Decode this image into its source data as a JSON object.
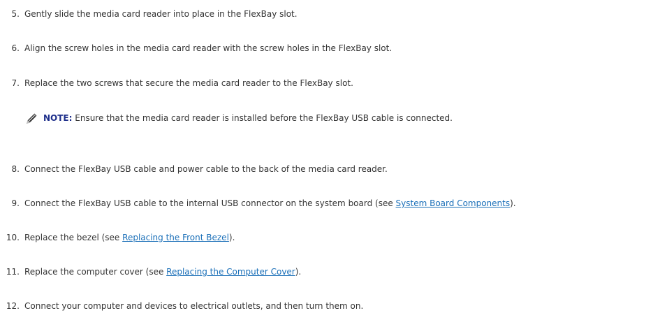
{
  "steps": [
    {
      "num": "5.",
      "before": "Gently slide the media card reader into place in the FlexBay slot.",
      "link": "",
      "after": ""
    },
    {
      "num": "6.",
      "before": "Align the screw holes in the media card reader with the screw holes in the FlexBay slot.",
      "link": "",
      "after": ""
    },
    {
      "num": "7.",
      "before": "Replace the two screws that secure the media card reader to the FlexBay slot.",
      "link": "",
      "after": ""
    },
    {
      "num": "8.",
      "before": "Connect the FlexBay USB cable and power cable to the back of the media card reader.",
      "link": "",
      "after": ""
    },
    {
      "num": "9.",
      "before": "Connect the FlexBay USB cable to the internal USB connector on the system board (see ",
      "link": "System Board Components",
      "after": ")."
    },
    {
      "num": "10.",
      "before": "Replace the bezel (see ",
      "link": "Replacing the Front Bezel",
      "after": ")."
    },
    {
      "num": "11.",
      "before": "Replace the computer cover (see ",
      "link": "Replacing the Computer Cover",
      "after": ")."
    },
    {
      "num": "12.",
      "before": "Connect your computer and devices to electrical outlets, and then turn them on.",
      "link": "",
      "after": ""
    }
  ],
  "note": {
    "icon": "note-pencil-icon",
    "label": "NOTE:",
    "text": " Ensure that the media card reader is installed before the FlexBay USB cable is connected."
  },
  "colors": {
    "link": "#1a6fb8",
    "note_label": "#1d2e8a",
    "text": "#333333"
  }
}
